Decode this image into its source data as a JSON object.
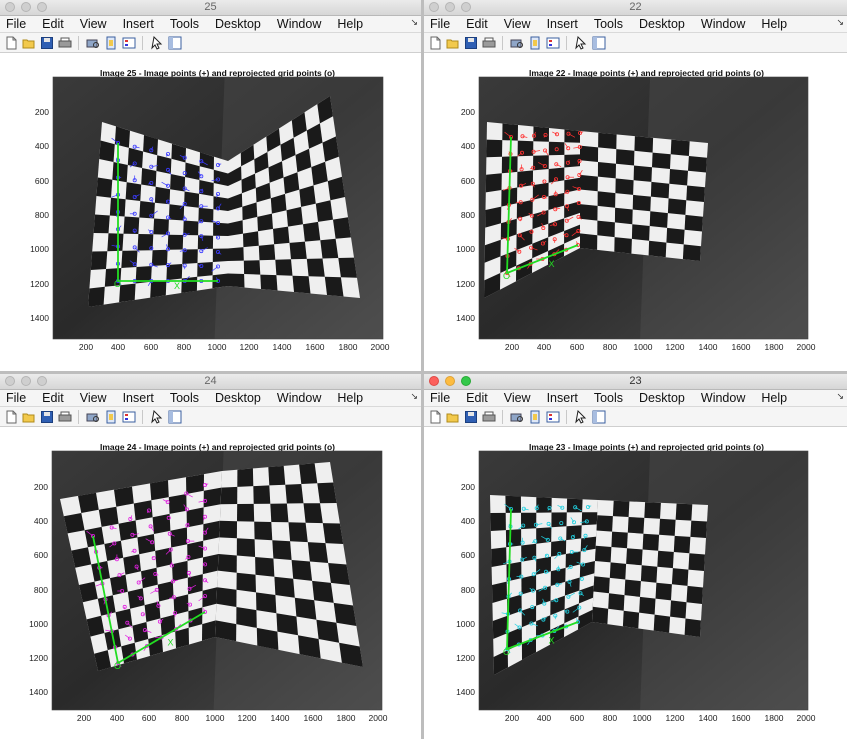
{
  "menu": [
    "File",
    "Edit",
    "View",
    "Insert",
    "Tools",
    "Desktop",
    "Window",
    "Help"
  ],
  "menu_overflow": "↘",
  "toolbar_icons": [
    "new-figure-icon",
    "open-file-icon",
    "save-icon",
    "print-icon",
    "print-preview-icon",
    "link-plot-icon",
    "insert-legend-icon",
    "pointer-icon",
    "property-editor-icon"
  ],
  "axes": {
    "xticks": [
      "200",
      "400",
      "600",
      "800",
      "1000",
      "1200",
      "1400",
      "1600",
      "1800",
      "2000"
    ],
    "yticks": [
      "200",
      "400",
      "600",
      "800",
      "1000",
      "1200",
      "1400"
    ]
  },
  "windows": [
    {
      "id": "25",
      "title": "25",
      "plot_title": "Image 25 - Image points (+) and reprojected grid points (o)",
      "active": false,
      "arrow_color": "#3b3bff",
      "origin_label": "O",
      "axis_label": "X"
    },
    {
      "id": "22",
      "title": "22",
      "plot_title": "Image 22 - Image points (+) and reprojected grid points (o)",
      "active": false,
      "arrow_color": "#ff3030",
      "origin_label": "O",
      "axis_label": "X"
    },
    {
      "id": "24",
      "title": "24",
      "plot_title": "Image 24 - Image points (+) and reprojected grid points (o)",
      "active": false,
      "arrow_color": "#e020e0",
      "origin_label": "O",
      "axis_label": "X"
    },
    {
      "id": "23",
      "title": "23",
      "plot_title": "Image 23 - Image points (+) and reprojected grid points (o)",
      "active": true,
      "arrow_color": "#20d0e0",
      "origin_label": "O",
      "axis_label": "X"
    }
  ]
}
